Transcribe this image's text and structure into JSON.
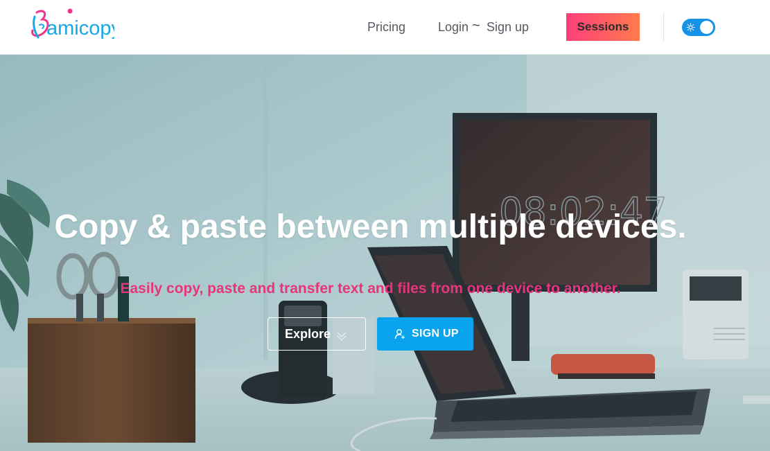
{
  "brand": {
    "logo_text": "amicopy",
    "colors": {
      "pink": "#f0338a",
      "blue": "#1aa7e6"
    }
  },
  "nav": {
    "pricing": "Pricing",
    "login": "Login",
    "separator": "~",
    "signup": "Sign up",
    "sessions": "Sessions",
    "theme_toggle": {
      "icon": "sun-icon",
      "state": "on"
    }
  },
  "hero": {
    "background": "desk-workspace-photo",
    "clock_display": "08:02:47",
    "title": "Copy & paste between multiple devices.",
    "subtitle": "Easily copy, paste and transfer text and files from one device to another.",
    "explore_label": "Explore",
    "signup_label": "SIGN UP"
  },
  "theme": {
    "accent_blue": "#0aa4ee",
    "sessions_gradient": [
      "#ff3e7b",
      "#ff7a4c"
    ],
    "subtitle_pink": "#e8347c"
  }
}
